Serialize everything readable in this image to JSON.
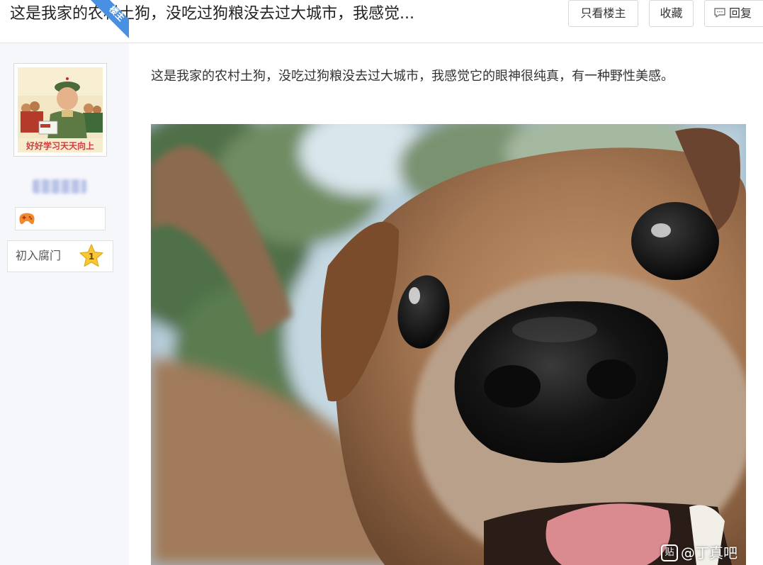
{
  "header": {
    "title": "这是我家的农村土狗，没吃过狗粮没去过大城市，我感觉...",
    "only_op_label": "只看楼主",
    "favorite_label": "收藏",
    "reply_label": "回复"
  },
  "author": {
    "badge_text": "楼主",
    "avatar_caption": "好好学习天天向上",
    "level_name": "初入腐门",
    "level_number": "1"
  },
  "post": {
    "text": "这是我家的农村土狗，没吃过狗粮没去过大城市，我感觉它的眼神很纯真，有一种野性美感。",
    "image_watermark": "@丁真吧",
    "watermark_icon_char": "贴"
  },
  "colors": {
    "badge_blue": "#4a90e2",
    "sidebar_bg": "#f6f7fb",
    "star_gold": "#f5c430"
  },
  "icons": {
    "reply": "speech-bubble-icon",
    "medal": "game-controller-icon",
    "level": "star-icon"
  }
}
